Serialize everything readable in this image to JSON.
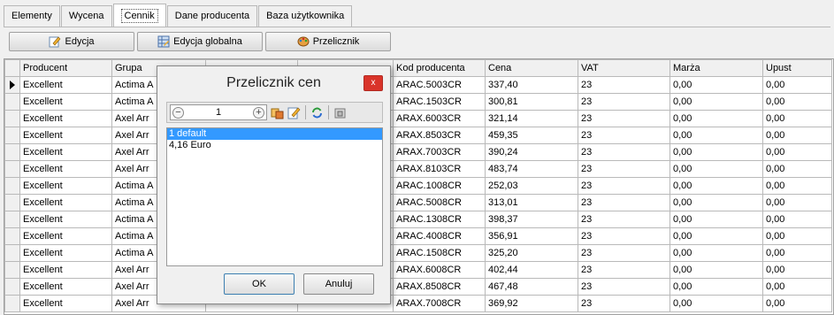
{
  "tabs": [
    {
      "label": "Elementy"
    },
    {
      "label": "Wycena"
    },
    {
      "label": "Cennik"
    },
    {
      "label": "Dane producenta"
    },
    {
      "label": "Baza użytkownika"
    }
  ],
  "active_tab": "Cennik",
  "toolbar": {
    "edit_label": "Edycja",
    "global_edit_label": "Edycja globalna",
    "converter_label": "Przelicznik"
  },
  "grid": {
    "columns": [
      "Producent",
      "Grupa",
      "",
      "",
      "Kod producenta",
      "Cena",
      "VAT",
      "Marża",
      "Upust"
    ],
    "rows": [
      {
        "producent": "Excellent",
        "grupa": "Actima A",
        "kod": "ARAC.5003CR",
        "cena": "337,40",
        "vat": "23",
        "marza": "0,00",
        "upust": "0,00"
      },
      {
        "producent": "Excellent",
        "grupa": "Actima A",
        "kod": "ARAC.1503CR",
        "cena": "300,81",
        "vat": "23",
        "marza": "0,00",
        "upust": "0,00"
      },
      {
        "producent": "Excellent",
        "grupa": "Axel Arr",
        "kod": "ARAX.6003CR",
        "cena": "321,14",
        "vat": "23",
        "marza": "0,00",
        "upust": "0,00"
      },
      {
        "producent": "Excellent",
        "grupa": "Axel Arr",
        "kod": "ARAX.8503CR",
        "cena": "459,35",
        "vat": "23",
        "marza": "0,00",
        "upust": "0,00"
      },
      {
        "producent": "Excellent",
        "grupa": "Axel Arr",
        "kod": "ARAX.7003CR",
        "cena": "390,24",
        "vat": "23",
        "marza": "0,00",
        "upust": "0,00"
      },
      {
        "producent": "Excellent",
        "grupa": "Axel Arr",
        "kod": "ARAX.8103CR",
        "cena": "483,74",
        "vat": "23",
        "marza": "0,00",
        "upust": "0,00"
      },
      {
        "producent": "Excellent",
        "grupa": "Actima A",
        "kod": "ARAC.1008CR",
        "cena": "252,03",
        "vat": "23",
        "marza": "0,00",
        "upust": "0,00"
      },
      {
        "producent": "Excellent",
        "grupa": "Actima A",
        "kod": "ARAC.5008CR",
        "cena": "313,01",
        "vat": "23",
        "marza": "0,00",
        "upust": "0,00"
      },
      {
        "producent": "Excellent",
        "grupa": "Actima A",
        "kod": "ARAC.1308CR",
        "cena": "398,37",
        "vat": "23",
        "marza": "0,00",
        "upust": "0,00"
      },
      {
        "producent": "Excellent",
        "grupa": "Actima A",
        "kod": "ARAC.4008CR",
        "cena": "356,91",
        "vat": "23",
        "marza": "0,00",
        "upust": "0,00"
      },
      {
        "producent": "Excellent",
        "grupa": "Actima A",
        "kod": "ARAC.1508CR",
        "cena": "325,20",
        "vat": "23",
        "marza": "0,00",
        "upust": "0,00"
      },
      {
        "producent": "Excellent",
        "grupa": "Axel Arr",
        "kod": "ARAX.6008CR",
        "cena": "402,44",
        "vat": "23",
        "marza": "0,00",
        "upust": "0,00"
      },
      {
        "producent": "Excellent",
        "grupa": "Axel Arr",
        "kod": "ARAX.8508CR",
        "cena": "467,48",
        "vat": "23",
        "marza": "0,00",
        "upust": "0,00"
      },
      {
        "producent": "Excellent",
        "grupa": "Axel Arr",
        "kod": "ARAX.7008CR",
        "cena": "369,92",
        "vat": "23",
        "marza": "0,00",
        "upust": "0,00"
      }
    ]
  },
  "dialog": {
    "title": "Przelicznik cen",
    "close_label": "x",
    "spinner_value": "1",
    "list_items": [
      "1 default",
      "4,16 Euro"
    ],
    "selected_index": 0,
    "ok_label": "OK",
    "cancel_label": "Anuluj"
  }
}
